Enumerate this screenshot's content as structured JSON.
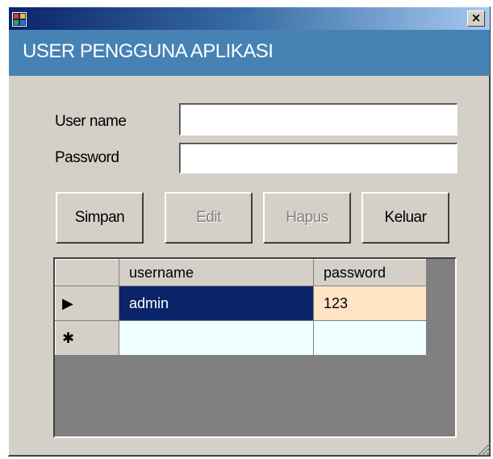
{
  "window": {
    "title": "",
    "close_label": "×",
    "app_icon": "windows-form-icon"
  },
  "header": {
    "title": "USER PENGGUNA APLIKASI",
    "background": "#4682b4"
  },
  "form": {
    "username_label": "User name",
    "username_value": "",
    "password_label": "Password",
    "password_value": ""
  },
  "buttons": {
    "simpan": "Simpan",
    "edit": "Edit",
    "hapus": "Hapus",
    "keluar": "Keluar"
  },
  "grid": {
    "columns": [
      "username",
      "password"
    ],
    "rows": [
      {
        "indicator": "▶",
        "username": "admin",
        "password": "123"
      },
      {
        "indicator": "✱",
        "username": "",
        "password": ""
      }
    ],
    "selected_color": "#0a246a",
    "alt_color": "#ffe4c4",
    "new_row_color": "#f0ffff"
  }
}
